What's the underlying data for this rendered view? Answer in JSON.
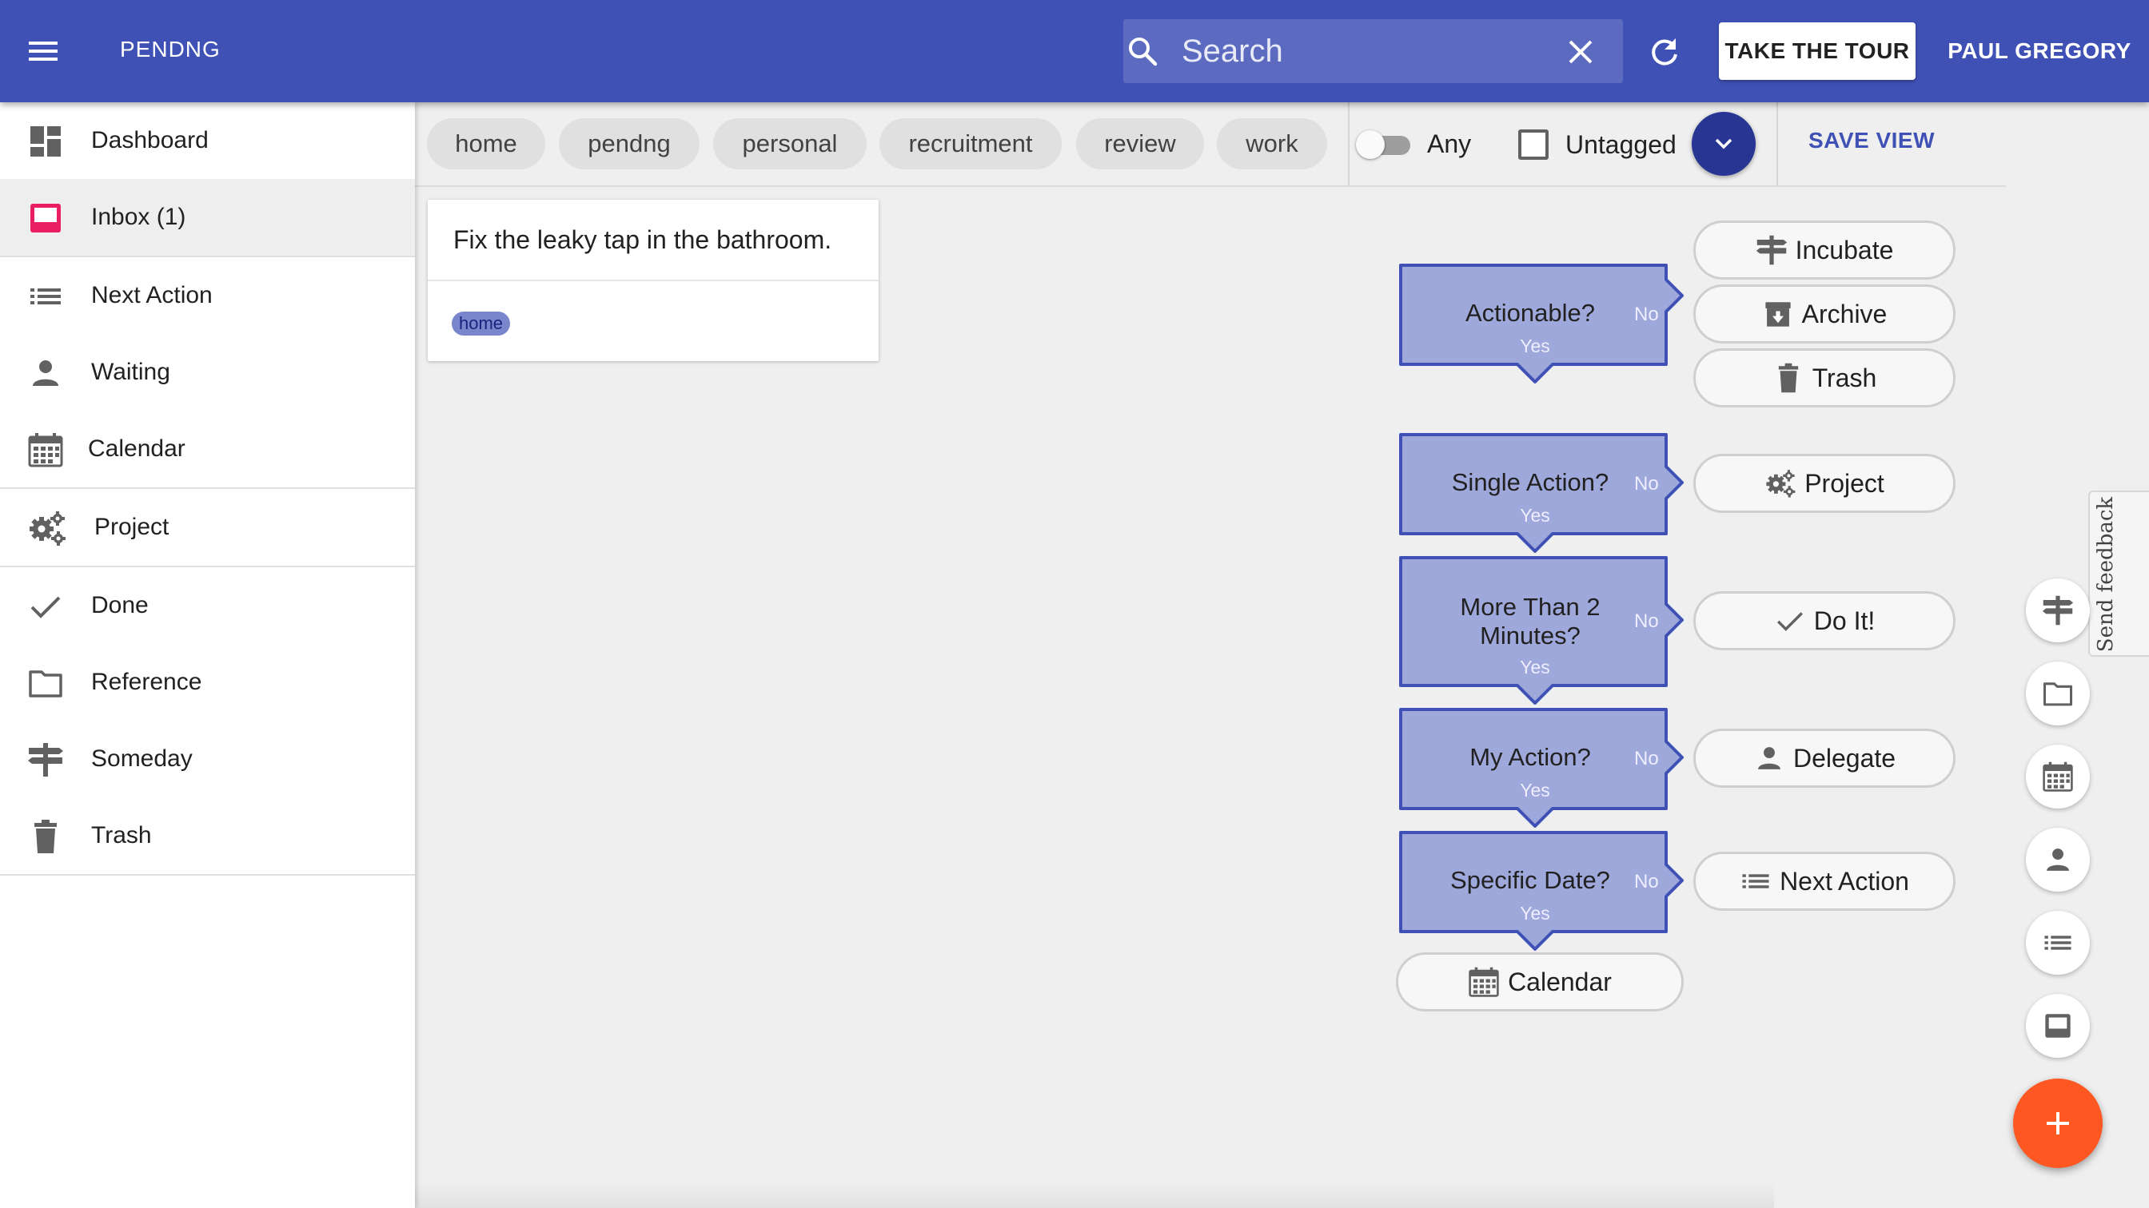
{
  "app": {
    "title": "PENDNG",
    "user_name": "PAUL GREGORY",
    "tour_label": "TAKE THE TOUR",
    "accent_color": "#3f51b5"
  },
  "search": {
    "placeholder": "Search",
    "value": ""
  },
  "sidebar": {
    "items": [
      {
        "label": "Dashboard",
        "icon": "dashboard-icon"
      },
      {
        "label": "Inbox (1)",
        "icon": "inbox-icon",
        "active": true
      },
      {
        "label": "Next Action",
        "icon": "list-icon"
      },
      {
        "label": "Waiting",
        "icon": "person-icon"
      },
      {
        "label": "Calendar",
        "icon": "calendar-icon"
      },
      {
        "label": "Project",
        "icon": "gears-icon"
      },
      {
        "label": "Done",
        "icon": "check-icon"
      },
      {
        "label": "Reference",
        "icon": "folder-icon"
      },
      {
        "label": "Someday",
        "icon": "signpost-icon"
      },
      {
        "label": "Trash",
        "icon": "trash-icon"
      }
    ]
  },
  "filters": {
    "tags": [
      "home",
      "pendng",
      "personal",
      "recruitment",
      "review",
      "work"
    ],
    "any_label": "Any",
    "any_enabled": false,
    "untagged_label": "Untagged",
    "untagged_checked": false,
    "save_view_label": "SAVE VIEW"
  },
  "tasks": [
    {
      "text": "Fix the leaky tap in the bathroom.",
      "tag": "home"
    }
  ],
  "workflow": {
    "decisions": [
      {
        "label": "Actionable?",
        "no": "No",
        "yes": "Yes"
      },
      {
        "label": "Single Action?",
        "no": "No",
        "yes": "Yes"
      },
      {
        "label": "More Than 2 Minutes?",
        "no": "No",
        "yes": "Yes"
      },
      {
        "label": "My Action?",
        "no": "No",
        "yes": "Yes"
      },
      {
        "label": "Specific Date?",
        "no": "No",
        "yes": "Yes"
      }
    ],
    "outcomes": {
      "incubate": "Incubate",
      "archive": "Archive",
      "trash": "Trash",
      "project": "Project",
      "do_it": "Do It!",
      "delegate": "Delegate",
      "next_action": "Next Action",
      "calendar": "Calendar"
    },
    "decision_color": "#9fa8da"
  },
  "feedback": {
    "label": "Send feedback"
  },
  "quick_actions": [
    "signpost-icon",
    "folder-icon",
    "calendar-icon",
    "person-icon",
    "list-icon",
    "inbox-icon"
  ],
  "fab": {
    "icon": "plus-icon",
    "color": "#ff5722"
  }
}
